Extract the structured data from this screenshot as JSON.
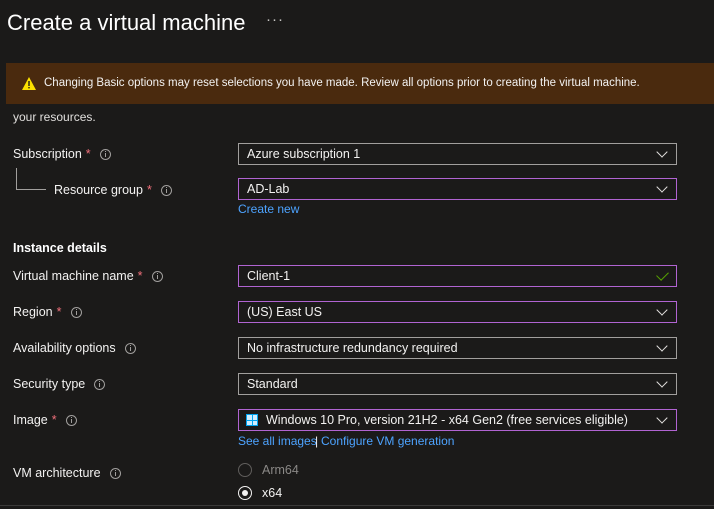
{
  "page": {
    "title": "Create a virtual machine",
    "more_label": "···"
  },
  "partial_text": {
    "top_line": "",
    "bottom_line": "your resources."
  },
  "banner": {
    "icon": "warning-icon",
    "text": "Changing Basic options may reset selections you have made. Review all options prior to creating the virtual machine.",
    "color": "#4a2a0e"
  },
  "form": {
    "subscription": {
      "label": "Subscription",
      "required": "*",
      "value": "Azure subscription 1"
    },
    "resource_group": {
      "label": "Resource group",
      "required": "*",
      "value": "AD-Lab",
      "link": "Create new"
    },
    "instance_details_heading": "Instance details",
    "vm_name": {
      "label": "Virtual machine name",
      "required": "*",
      "value": "Client-1"
    },
    "region": {
      "label": "Region",
      "required": "*",
      "value": "(US) East US"
    },
    "availability": {
      "label": "Availability options",
      "value": "No infrastructure redundancy required"
    },
    "security_type": {
      "label": "Security type",
      "value": "Standard"
    },
    "image": {
      "label": "Image",
      "required": "*",
      "value": "Windows 10 Pro, version 21H2 - x64 Gen2 (free services eligible)",
      "icon": "windows-icon",
      "link_all": "See all images",
      "separator": "|",
      "link_configure": "Configure VM generation"
    },
    "vm_architecture": {
      "label": "VM architecture",
      "options": [
        {
          "label": "Arm64",
          "selected": false,
          "disabled": true
        },
        {
          "label": "x64",
          "selected": true,
          "disabled": false
        }
      ]
    }
  },
  "colors": {
    "background": "#1b1a19",
    "accent_focus": "#b164d2",
    "link": "#4da3ff",
    "required": "#f1707b",
    "valid": "#57a300"
  }
}
